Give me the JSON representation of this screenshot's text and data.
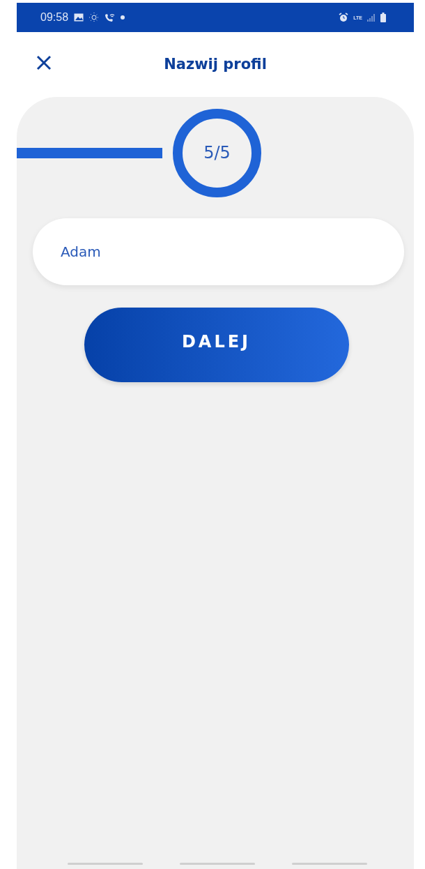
{
  "status_bar": {
    "time": "09:58",
    "network": "LTE"
  },
  "header": {
    "title": "Nazwij profil"
  },
  "progress": {
    "step": "5/5"
  },
  "name_field": {
    "value": "Adam"
  },
  "next_button": {
    "label": "DALEJ"
  }
}
